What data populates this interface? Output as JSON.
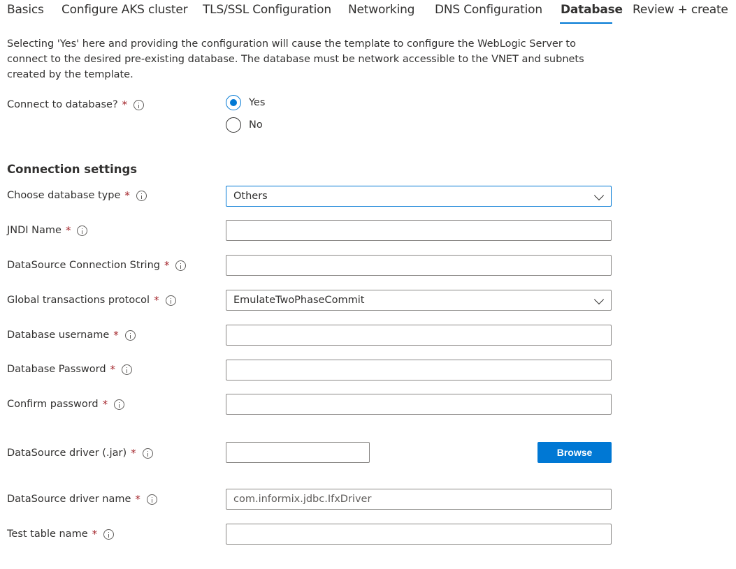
{
  "tabs": [
    {
      "label": "Basics"
    },
    {
      "label": "Configure AKS cluster"
    },
    {
      "label": "TLS/SSL Configuration"
    },
    {
      "label": "Networking"
    },
    {
      "label": "DNS Configuration"
    },
    {
      "label": "Database"
    },
    {
      "label": "Review + create"
    }
  ],
  "intro": "Selecting 'Yes' here and providing the configuration will cause the template to configure the WebLogic Server to connect to the desired pre-existing database. The database must be network accessible to the VNET and subnets created by the template.",
  "connect": {
    "label": "Connect to database?",
    "options": [
      "Yes",
      "No"
    ],
    "selected": "Yes"
  },
  "section_title": "Connection settings",
  "required_marker": "*",
  "fields": {
    "db_type": {
      "label": "Choose database type",
      "value": "Others"
    },
    "jndi": {
      "label": "JNDI Name",
      "value": ""
    },
    "conn_string": {
      "label": "DataSource Connection String",
      "value": ""
    },
    "global_tx": {
      "label": "Global transactions protocol",
      "value": "EmulateTwoPhaseCommit"
    },
    "username": {
      "label": "Database username",
      "value": ""
    },
    "password": {
      "label": "Database Password",
      "value": ""
    },
    "confirm": {
      "label": "Confirm password",
      "value": ""
    },
    "driver_jar": {
      "label": "DataSource driver (.jar)",
      "button": "Browse"
    },
    "driver_name": {
      "label": "DataSource driver name",
      "value": "com.informix.jdbc.IfxDriver"
    },
    "test_table": {
      "label": "Test table name",
      "value": ""
    }
  },
  "colors": {
    "accent": "#0078d4",
    "required": "#a4262c",
    "border": "#8a8886"
  }
}
